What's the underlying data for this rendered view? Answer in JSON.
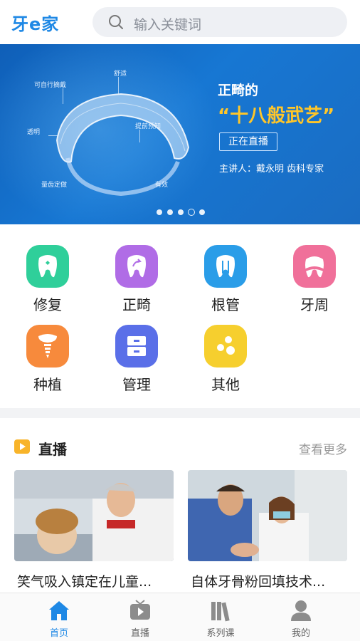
{
  "header": {
    "logo": "牙e家",
    "search_placeholder": "输入关键词"
  },
  "banner": {
    "title_line1": "正畸的",
    "title_line2": "“十八般武艺”",
    "live_button": "正在直播",
    "host": "主讲人：戴永明  齿科专家",
    "tray_labels": [
      "舒适",
      "可自行摘戴",
      "透明",
      "提前预知",
      "量齿定做",
      "有效"
    ],
    "dots": 5,
    "active_dot": 4
  },
  "categories": [
    {
      "label": "修复",
      "color": "#2fcf9a",
      "icon": "tooth-repair-icon"
    },
    {
      "label": "正畸",
      "color": "#b06ce6",
      "icon": "tooth-orthodontic-icon"
    },
    {
      "label": "根管",
      "color": "#2a9de8",
      "icon": "tooth-root-canal-icon"
    },
    {
      "label": "牙周",
      "color": "#f0709a",
      "icon": "gum-icon"
    },
    {
      "label": "种植",
      "color": "#f78a3c",
      "icon": "implant-icon"
    },
    {
      "label": "管理",
      "color": "#5a6fe8",
      "icon": "drawer-icon"
    },
    {
      "label": "其他",
      "color": "#f6cf2e",
      "icon": "dots-icon"
    }
  ],
  "live": {
    "title": "直播",
    "more": "查看更多",
    "cards": [
      {
        "title": "笑气吸入镇定在儿童..."
      },
      {
        "title": "自体牙骨粉回填技术..."
      }
    ]
  },
  "tabbar": {
    "items": [
      {
        "label": "首页",
        "active": true
      },
      {
        "label": "直播",
        "active": false
      },
      {
        "label": "系列课",
        "active": false
      },
      {
        "label": "我的",
        "active": false
      }
    ]
  },
  "colors": {
    "accent": "#1e88e5",
    "banner": "#1777d3",
    "highlight": "#ffc629"
  }
}
